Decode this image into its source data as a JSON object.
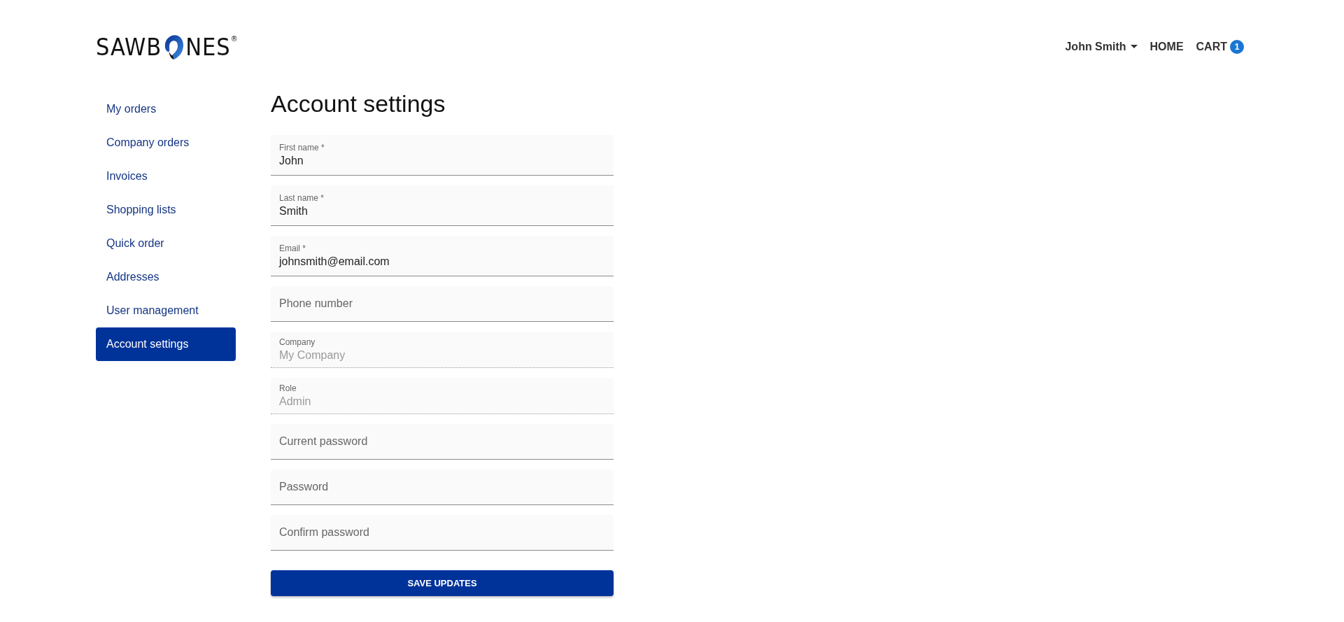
{
  "header": {
    "logo": {
      "left": "SAWB",
      "right": "NES",
      "mark": "®"
    },
    "user_menu": "John Smith",
    "nav": [
      {
        "label": "HOME"
      },
      {
        "label": "CART",
        "badge": "1"
      }
    ]
  },
  "sidebar": {
    "items": [
      {
        "label": "My orders",
        "selected": false
      },
      {
        "label": "Company orders",
        "selected": false
      },
      {
        "label": "Invoices",
        "selected": false
      },
      {
        "label": "Shopping lists",
        "selected": false
      },
      {
        "label": "Quick order",
        "selected": false
      },
      {
        "label": "Addresses",
        "selected": false
      },
      {
        "label": "User management",
        "selected": false
      },
      {
        "label": "Account settings",
        "selected": true
      }
    ]
  },
  "page_title": "Account settings",
  "form": {
    "fields": [
      {
        "label": "First name *",
        "value": "John",
        "disabled": false
      },
      {
        "label": "Last name *",
        "value": "Smith",
        "disabled": false
      },
      {
        "label": "Email *",
        "value": "johnsmith@email.com",
        "disabled": false
      },
      {
        "label": "Phone number",
        "disabled": false
      },
      {
        "label": "Company",
        "value": "My Company",
        "disabled": true
      },
      {
        "label": "Role",
        "value": "Admin",
        "disabled": true
      },
      {
        "label": "Current password",
        "disabled": false
      },
      {
        "label": "Password",
        "disabled": false
      },
      {
        "label": "Confirm password",
        "disabled": false
      }
    ],
    "submit": "SAVE UPDATES"
  }
}
